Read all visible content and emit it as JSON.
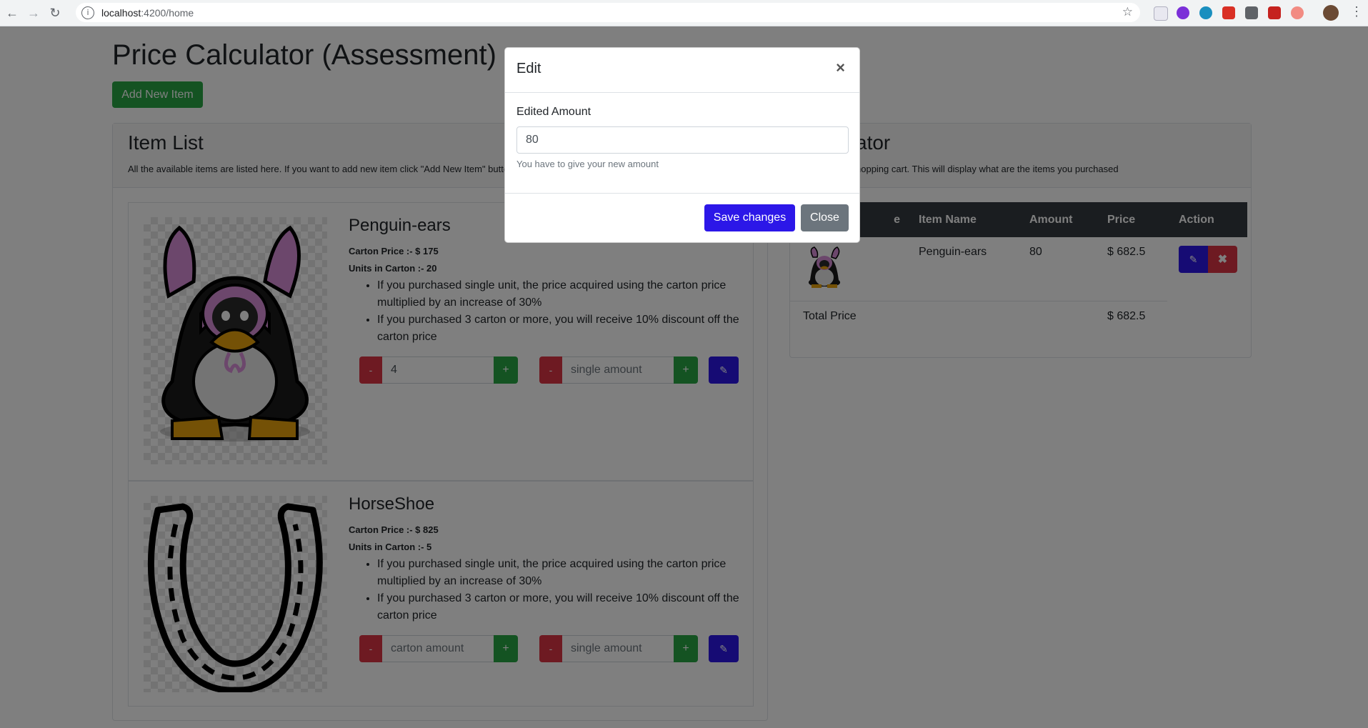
{
  "browser": {
    "url_host": "localhost",
    "url_path": ":4200/home"
  },
  "page": {
    "title": "Price Calculator (Assessment)",
    "add_button": "Add New Item"
  },
  "item_list": {
    "heading": "Item List",
    "description": "All the available items are listed here. If you want to add new item click \"Add New Item\" button",
    "items": [
      {
        "name": "Penguin-ears",
        "carton_price": "Carton Price :- $ 175",
        "units_in_carton": "Units in Carton :- 20",
        "rules": [
          "If you purchased single unit, the price acquired using the carton price multiplied by an increase of 30%",
          "If you purchased 3 carton or more, you will receive 10% discount off the carton price"
        ],
        "carton_value": "4",
        "carton_placeholder": "carton amount",
        "single_value": "",
        "single_placeholder": "single amount",
        "minus": "-",
        "plus": "+"
      },
      {
        "name": "HorseShoe",
        "carton_price": "Carton Price :- $ 825",
        "units_in_carton": "Units in Carton :- 5",
        "rules": [
          "If you purchased single unit, the price acquired using the carton price multiplied by an increase of 30%",
          "If you purchased 3 carton or more, you will receive 10% discount off the carton price"
        ],
        "carton_value": "",
        "carton_placeholder": "carton amount",
        "single_value": "",
        "single_placeholder": "single amount",
        "minus": "-",
        "plus": "+"
      }
    ]
  },
  "calculator": {
    "heading_visible": "ator",
    "description_visible": "hopping cart. This will display what are the items you purchased",
    "columns": [
      "e",
      "Item Name",
      "Amount",
      "Price",
      "Action"
    ],
    "rows": [
      {
        "name": "Penguin-ears",
        "amount": "80",
        "price": "$ 682.5"
      }
    ],
    "total_label": "Total Price",
    "total_value": "$ 682.5"
  },
  "modal": {
    "title": "Edit",
    "close_x": "×",
    "label": "Edited Amount",
    "input_value": "80",
    "help": "You have to give your new amount",
    "save": "Save changes",
    "close": "Close"
  },
  "colors": {
    "primary": "#2c17e8",
    "success": "#28a745",
    "danger": "#dc3545",
    "secondary": "#6c757d",
    "dark": "#343a40"
  },
  "icons": {
    "edit": "edit-icon",
    "delete": "x-icon"
  }
}
